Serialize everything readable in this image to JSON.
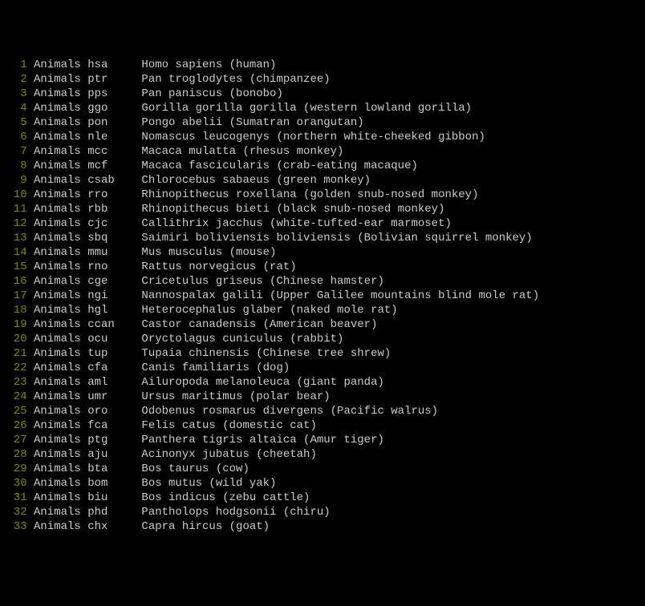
{
  "rows": [
    {
      "n": "1",
      "cat": "Animals",
      "code": "hsa",
      "desc": "Homo sapiens (human)"
    },
    {
      "n": "2",
      "cat": "Animals",
      "code": "ptr",
      "desc": "Pan troglodytes (chimpanzee)"
    },
    {
      "n": "3",
      "cat": "Animals",
      "code": "pps",
      "desc": "Pan paniscus (bonobo)"
    },
    {
      "n": "4",
      "cat": "Animals",
      "code": "ggo",
      "desc": "Gorilla gorilla gorilla (western lowland gorilla)"
    },
    {
      "n": "5",
      "cat": "Animals",
      "code": "pon",
      "desc": "Pongo abelii (Sumatran orangutan)"
    },
    {
      "n": "6",
      "cat": "Animals",
      "code": "nle",
      "desc": "Nomascus leucogenys (northern white-cheeked gibbon)"
    },
    {
      "n": "7",
      "cat": "Animals",
      "code": "mcc",
      "desc": "Macaca mulatta (rhesus monkey)"
    },
    {
      "n": "8",
      "cat": "Animals",
      "code": "mcf",
      "desc": "Macaca fascicularis (crab-eating macaque)"
    },
    {
      "n": "9",
      "cat": "Animals",
      "code": "csab",
      "desc": "Chlorocebus sabaeus (green monkey)"
    },
    {
      "n": "10",
      "cat": "Animals",
      "code": "rro",
      "desc": "Rhinopithecus roxellana (golden snub-nosed monkey)"
    },
    {
      "n": "11",
      "cat": "Animals",
      "code": "rbb",
      "desc": "Rhinopithecus bieti (black snub-nosed monkey)"
    },
    {
      "n": "12",
      "cat": "Animals",
      "code": "cjc",
      "desc": "Callithrix jacchus (white-tufted-ear marmoset)"
    },
    {
      "n": "13",
      "cat": "Animals",
      "code": "sbq",
      "desc": "Saimiri boliviensis boliviensis (Bolivian squirrel monkey)"
    },
    {
      "n": "14",
      "cat": "Animals",
      "code": "mmu",
      "desc": "Mus musculus (mouse)"
    },
    {
      "n": "15",
      "cat": "Animals",
      "code": "rno",
      "desc": "Rattus norvegicus (rat)"
    },
    {
      "n": "16",
      "cat": "Animals",
      "code": "cge",
      "desc": "Cricetulus griseus (Chinese hamster)"
    },
    {
      "n": "17",
      "cat": "Animals",
      "code": "ngi",
      "desc": "Nannospalax galili (Upper Galilee mountains blind mole rat)"
    },
    {
      "n": "18",
      "cat": "Animals",
      "code": "hgl",
      "desc": "Heterocephalus glaber (naked mole rat)"
    },
    {
      "n": "19",
      "cat": "Animals",
      "code": "ccan",
      "desc": "Castor canadensis (American beaver)"
    },
    {
      "n": "20",
      "cat": "Animals",
      "code": "ocu",
      "desc": "Oryctolagus cuniculus (rabbit)"
    },
    {
      "n": "21",
      "cat": "Animals",
      "code": "tup",
      "desc": "Tupaia chinensis (Chinese tree shrew)"
    },
    {
      "n": "22",
      "cat": "Animals",
      "code": "cfa",
      "desc": "Canis familiaris (dog)"
    },
    {
      "n": "23",
      "cat": "Animals",
      "code": "aml",
      "desc": "Ailuropoda melanoleuca (giant panda)"
    },
    {
      "n": "24",
      "cat": "Animals",
      "code": "umr",
      "desc": "Ursus maritimus (polar bear)"
    },
    {
      "n": "25",
      "cat": "Animals",
      "code": "oro",
      "desc": "Odobenus rosmarus divergens (Pacific walrus)"
    },
    {
      "n": "26",
      "cat": "Animals",
      "code": "fca",
      "desc": "Felis catus (domestic cat)"
    },
    {
      "n": "27",
      "cat": "Animals",
      "code": "ptg",
      "desc": "Panthera tigris altaica (Amur tiger)"
    },
    {
      "n": "28",
      "cat": "Animals",
      "code": "aju",
      "desc": "Acinonyx jubatus (cheetah)"
    },
    {
      "n": "29",
      "cat": "Animals",
      "code": "bta",
      "desc": "Bos taurus (cow)"
    },
    {
      "n": "30",
      "cat": "Animals",
      "code": "bom",
      "desc": "Bos mutus (wild yak)"
    },
    {
      "n": "31",
      "cat": "Animals",
      "code": "biu",
      "desc": "Bos indicus (zebu cattle)"
    },
    {
      "n": "32",
      "cat": "Animals",
      "code": "phd",
      "desc": "Pantholops hodgsonii (chiru)"
    },
    {
      "n": "33",
      "cat": "Animals",
      "code": "chx",
      "desc": "Capra hircus (goat)"
    }
  ]
}
